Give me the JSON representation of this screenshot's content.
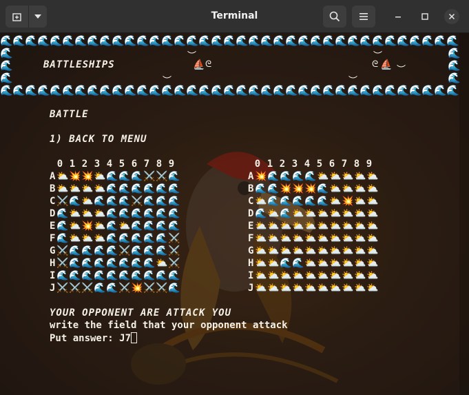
{
  "window": {
    "title": "Terminal",
    "icons": {
      "new_tab": "new-tab-icon",
      "dropdown": "chevron-down-icon",
      "search": "search-icon",
      "menu": "hamburger-menu-icon",
      "minimize": "minimize-icon",
      "maximize": "maximize-icon",
      "close": "close-icon"
    }
  },
  "banner": {
    "wave": "🌊",
    "title": "BATTLESHIPS",
    "boat_left": "⛵",
    "boat_right": "⛵",
    "birds": [
      "︶",
      "︶",
      "︶",
      "︶",
      "︶"
    ],
    "swirl": "ᘓ"
  },
  "screen": {
    "heading": "BATTLE",
    "menu_option": "1) BACK TO MENU",
    "column_labels": [
      "0",
      "1",
      "2",
      "3",
      "4",
      "5",
      "6",
      "7",
      "8",
      "9"
    ],
    "row_labels": [
      "A",
      "B",
      "C",
      "D",
      "E",
      "F",
      "G",
      "H",
      "I",
      "J"
    ]
  },
  "legend_symbols": {
    "W": "🌊",
    "C": "⛅",
    "X": "💥",
    "S": "⚔️"
  },
  "player_board": [
    "CXXCWWWSSW",
    "CCCCWWWWWW",
    "SWCWWWSWWW",
    "WCCCWWWWWW",
    "WCXCWCWWWW",
    "WCCCWWWWWS",
    "SWWWWSWWWS",
    "SWWWWWWWCS",
    "WWWWWWWWWW",
    "SSSWWSXSSW"
  ],
  "opponent_board": [
    "XWWWWCCCCC",
    "WWXXXWCCCC",
    "CWWWWWCXCC",
    "WCWCCCCCCC",
    "CCCCCCCCCC",
    "CCCCCCCCCC",
    "CCCCCCCCCC",
    "CCWWCCCCCC",
    "CCCCCCCCCC",
    "CCCCCCCCCC"
  ],
  "prompt": {
    "line1": "YOUR OPPONENT ARE ATTACK YOU",
    "line2": "write the field that your opponent attack",
    "line3_label": "Put answer: ",
    "line3_value": "J7"
  }
}
